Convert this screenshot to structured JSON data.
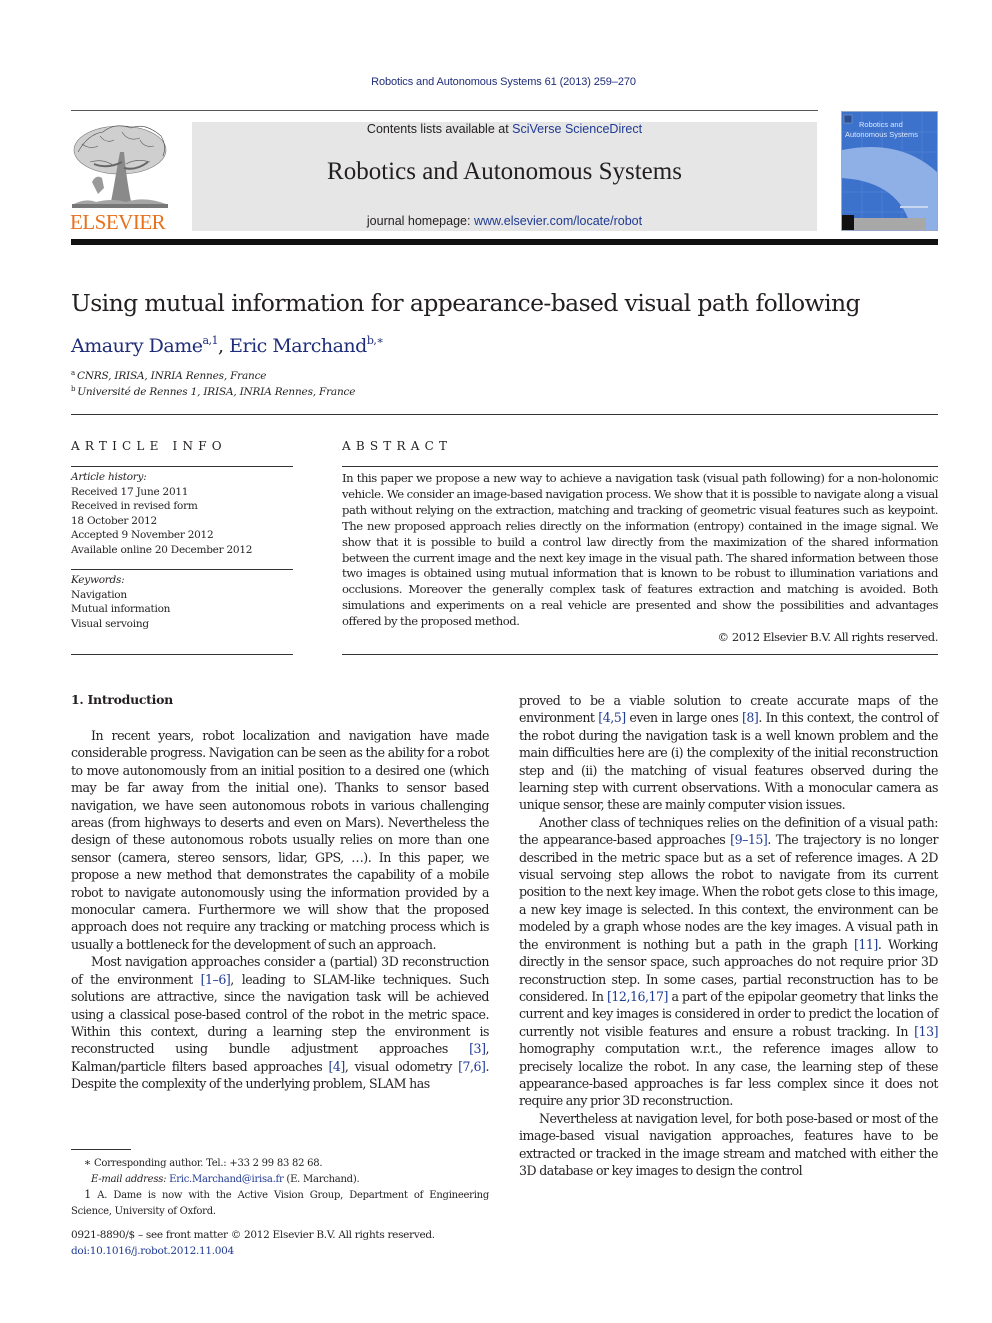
{
  "header": {
    "citation": "Robotics and Autonomous Systems 61 (2013) 259–270",
    "publisher_wordmark": "ELSEVIER",
    "contents_prefix": "Contents lists available at ",
    "contents_link": "SciVerse ScienceDirect",
    "journal_name": "Robotics and Autonomous Systems",
    "homepage_prefix": "journal homepage: ",
    "homepage_link": "www.elsevier.com/locate/robot",
    "cover_title_line1": "Robotics and",
    "cover_title_line2": "Autonomous Systems"
  },
  "article": {
    "title": "Using mutual information for appearance-based visual path following",
    "authors": [
      {
        "name": "Amaury Dame",
        "sup": "a,1"
      },
      {
        "name": "Eric Marchand",
        "sup": "b,∗"
      }
    ],
    "author_separator": ", ",
    "affiliations": [
      {
        "mark": "a",
        "text": "CNRS, IRISA, INRIA Rennes, France"
      },
      {
        "mark": "b",
        "text": "Université de Rennes 1, IRISA, INRIA Rennes, France"
      }
    ]
  },
  "article_info": {
    "label": "ARTICLE INFO",
    "history_label": "Article history:",
    "history": [
      "Received 17 June 2011",
      "Received in revised form",
      "18 October 2012",
      "Accepted 9 November 2012",
      "Available online 20 December 2012"
    ],
    "keywords_label": "Keywords:",
    "keywords": [
      "Navigation",
      "Mutual information",
      "Visual servoing"
    ]
  },
  "abstract": {
    "label": "ABSTRACT",
    "text": "In this paper we propose a new way to achieve a navigation task (visual path following) for a non-holonomic vehicle. We consider an image-based navigation process. We show that it is possible to navigate along a visual path without relying on the extraction, matching and tracking of geometric visual features such as keypoint. The new proposed approach relies directly on the information (entropy) contained in the image signal. We show that it is possible to build a control law directly from the maximization of the shared information between the current image and the next key image in the visual path. The shared information between those two images is obtained using mutual information that is known to be robust to illumination variations and occlusions. Moreover the generally complex task of features extraction and matching is avoided. Both simulations and experiments on a real vehicle are presented and show the possibilities and advantages offered by the proposed method.",
    "copyright": "© 2012 Elsevier B.V. All rights reserved."
  },
  "body": {
    "section_heading": "1.  Introduction",
    "left_paragraphs": [
      {
        "segments": [
          {
            "t": "In recent years, robot localization and navigation have made considerable progress. Navigation can be seen as the ability for a robot to move autonomously from an initial position to a desired one (which may be far away from the initial one). Thanks to sensor based navigation, we have seen autonomous robots in various challenging areas (from highways to deserts and even on Mars). Nevertheless the design of these autonomous robots usually relies on more than one sensor (camera, stereo sensors, lidar, GPS, …). In this paper, we propose a new method that demonstrates the capability of a mobile robot to navigate autonomously using the information provided by a monocular camera. Furthermore we will show that the proposed approach does not require any tracking or matching process which is usually a bottleneck for the development of such an approach."
          }
        ]
      },
      {
        "segments": [
          {
            "t": "Most navigation approaches consider a (partial) 3D reconstruction of the environment "
          },
          {
            "ref": "[1–6]"
          },
          {
            "t": ", leading to SLAM-like techniques. Such solutions are attractive, since the navigation task will be achieved using a classical pose-based control of the robot in the metric space. Within this context, during a learning step the environment is reconstructed using bundle adjustment approaches "
          },
          {
            "ref": "[3]"
          },
          {
            "t": ", Kalman/particle filters based approaches "
          },
          {
            "ref": "[4]"
          },
          {
            "t": ", visual odometry "
          },
          {
            "ref": "[7,6]"
          },
          {
            "t": ". Despite the complexity of the underlying problem, SLAM has"
          }
        ]
      }
    ],
    "right_paragraphs": [
      {
        "noindent": true,
        "segments": [
          {
            "t": "proved to be a viable solution to create accurate maps of the environment "
          },
          {
            "ref": "[4,5]"
          },
          {
            "t": " even in large ones "
          },
          {
            "ref": "[8]"
          },
          {
            "t": ". In this context, the control of the robot during the navigation task is a well known problem and the main difficulties here are (i) the complexity of the initial reconstruction step and (ii) the matching of visual features observed during the learning step with current observations. With a monocular camera as unique sensor, these are mainly computer vision issues."
          }
        ]
      },
      {
        "segments": [
          {
            "t": "Another class of techniques relies on the definition of a visual path: the appearance-based approaches "
          },
          {
            "ref": "[9–15]"
          },
          {
            "t": ". The trajectory is no longer described in the metric space but as a set of reference images. A 2D visual servoing step allows the robot to navigate from its current position to the next key image. When the robot gets close to this image, a new key image is selected. In this context, the environment can be modeled by a graph whose nodes are the key images. A visual path in the environment is nothing but a path in the graph "
          },
          {
            "ref": "[11]"
          },
          {
            "t": ". Working directly in the sensor space, such approaches do not require prior 3D reconstruction step. In some cases, partial reconstruction has to be considered. In "
          },
          {
            "ref": "[12,16,17]"
          },
          {
            "t": " a part of the epipolar geometry that links the current and key images is considered in order to predict the location of currently not visible features and ensure a robust tracking. In "
          },
          {
            "ref": "[13]"
          },
          {
            "t": " homography computation w.r.t., the reference images allow to precisely localize the robot. In any case, the learning step of these appearance-based approaches is far less complex since it does not require any prior 3D reconstruction."
          }
        ]
      },
      {
        "segments": [
          {
            "t": "Nevertheless at navigation level, for both pose-based or most of the image-based visual navigation approaches, features have to be extracted or tracked in the image stream and matched with either the 3D database or key images to design the control"
          }
        ]
      }
    ]
  },
  "footnotes": {
    "corresponding_marker": "∗",
    "corresponding_text": "Corresponding author. Tel.: +33 2 99 83 82 68.",
    "email_label": "E-mail address: ",
    "email": "Eric.Marchand@irisa.fr",
    "email_suffix": " (E. Marchand).",
    "dame_marker": "1",
    "dame_text": "A. Dame is now with the Active Vision Group, Department of Engineering Science, University of Oxford.",
    "issn": "0921-8890/$ – see front matter © 2012 Elsevier B.V. All rights reserved.",
    "doi": "doi:10.1016/j.robot.2012.11.004"
  },
  "colors": {
    "link": "#1f3a93",
    "elsevier_orange": "#e9711c",
    "masthead_gray": "#e6e6e6",
    "cover_blue": "#3a6fc9"
  }
}
